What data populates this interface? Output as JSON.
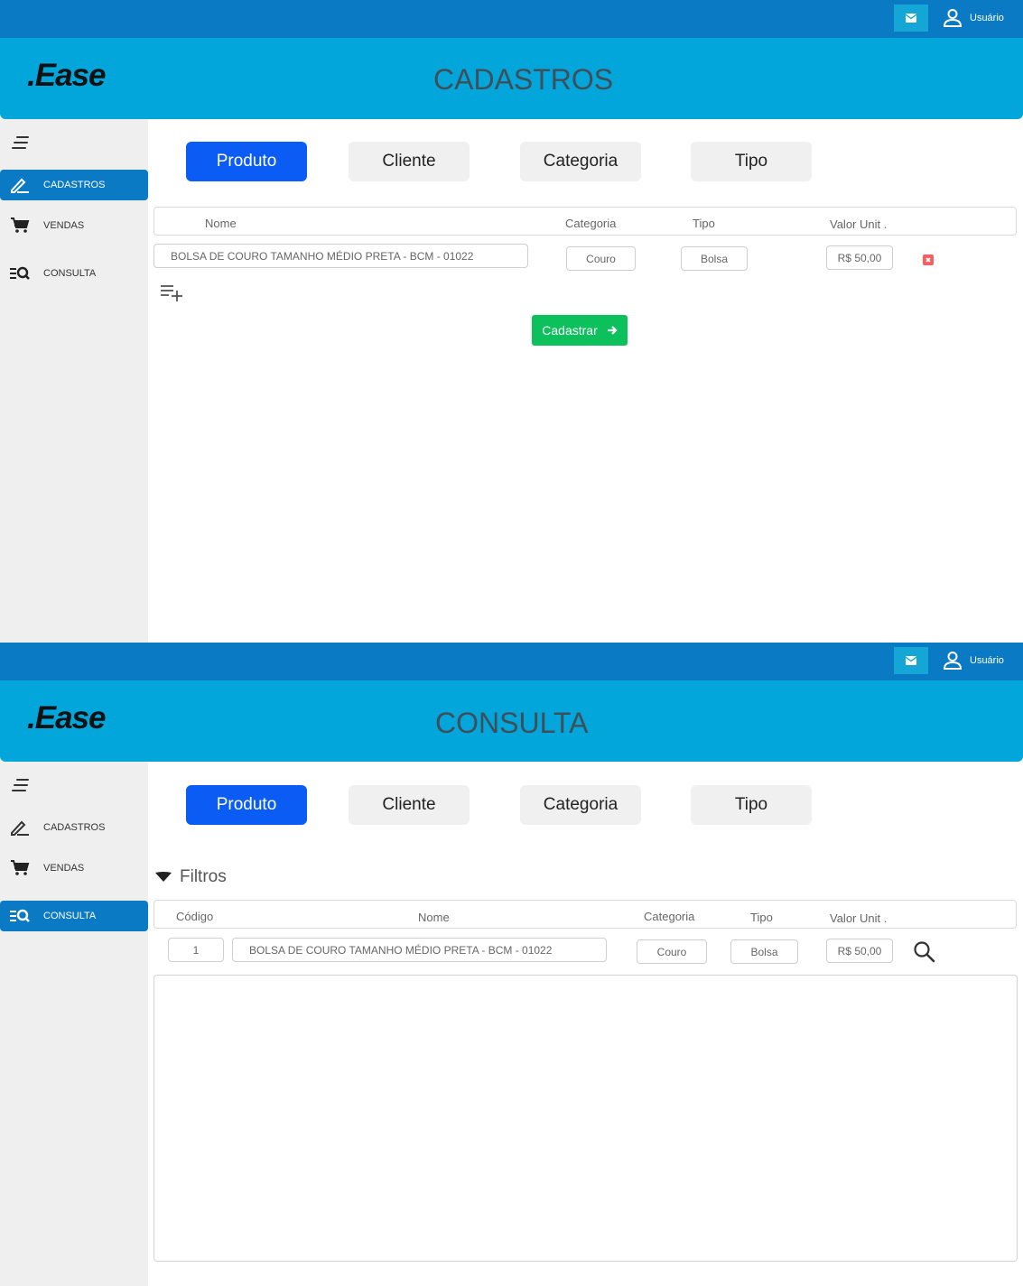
{
  "screens": [
    {
      "topbar": {
        "user_label": "Usuário"
      },
      "header": {
        "logo": ".Ease",
        "title": "CADASTROS"
      },
      "sidebar": {
        "items": [
          {
            "label": "CADASTROS",
            "active": true
          },
          {
            "label": "VENDAS",
            "active": false
          },
          {
            "label": "CONSULTA",
            "active": false
          }
        ]
      },
      "tabs": [
        {
          "label": "Produto",
          "active": true
        },
        {
          "label": "Cliente"
        },
        {
          "label": "Categoria"
        },
        {
          "label": "Tipo"
        }
      ],
      "columns": {
        "nome": "Nome",
        "categoria": "Categoria",
        "tipo": "Tipo",
        "valor": "Valor Unit ."
      },
      "row": {
        "nome": "BOLSA DE COURO TAMANHO MÉDIO PRETA - BCM - 01022",
        "categoria": "Couro",
        "tipo": "Bolsa",
        "valor": "R$ 50,00"
      },
      "submit_label": "Cadastrar"
    },
    {
      "topbar": {
        "user_label": "Usuário"
      },
      "header": {
        "logo": ".Ease",
        "title": "CONSULTA"
      },
      "sidebar": {
        "items": [
          {
            "label": "CADASTROS",
            "active": false
          },
          {
            "label": "VENDAS",
            "active": false
          },
          {
            "label": "CONSULTA",
            "active": true
          }
        ]
      },
      "tabs": [
        {
          "label": "Produto",
          "active": true
        },
        {
          "label": "Cliente"
        },
        {
          "label": "Categoria"
        },
        {
          "label": "Tipo"
        }
      ],
      "filters_label": "Filtros",
      "columns": {
        "codigo": "Código",
        "nome": "Nome",
        "categoria": "Categoria",
        "tipo": "Tipo",
        "valor": "Valor Unit ."
      },
      "row": {
        "codigo": "1",
        "nome": "BOLSA DE COURO TAMANHO MÉDIO PRETA - BCM - 01022",
        "categoria": "Couro",
        "tipo": "Bolsa",
        "valor": "R$ 50,00"
      }
    }
  ],
  "colors": {
    "topbar": "#0a7ac4",
    "header": "#02a6da",
    "tab_active": "#0a5cf5",
    "submit": "#0cc15c",
    "delete": "#f06060"
  },
  "icons": [
    "mail-icon",
    "user-icon",
    "menu-icon",
    "pencil-icon",
    "cart-icon",
    "list-search-icon",
    "delete-icon",
    "add-row-icon",
    "arrow-right-icon",
    "caret-down-icon",
    "search-icon"
  ]
}
